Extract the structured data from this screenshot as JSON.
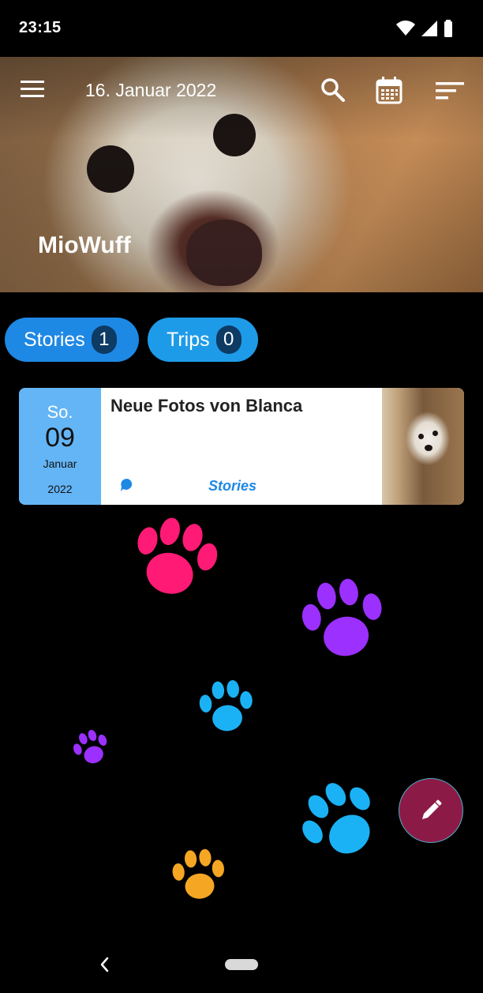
{
  "status_bar": {
    "time": "23:15"
  },
  "header": {
    "date": "16. Januar 2022",
    "app_title": "MioWuff",
    "icons": [
      "menu-icon",
      "search-icon",
      "calendar-icon",
      "sort-icon"
    ]
  },
  "filters": [
    {
      "label": "Stories",
      "count": "1"
    },
    {
      "label": "Trips",
      "count": "0"
    }
  ],
  "entries": [
    {
      "weekday": "So.",
      "day": "09",
      "month": "Januar",
      "year": "2022",
      "title": "Neue Fotos von Blanca",
      "category": "Stories",
      "category_icon": "story-bubble-icon"
    }
  ],
  "fab": {
    "icon": "pencil-icon"
  },
  "colors": {
    "chip": "#1e88e5",
    "chip_count": "#0d3b63",
    "card_date": "#64b5f6",
    "category": "#1e88e5",
    "fab": "#8c1a47",
    "paws": [
      "#ff1a75",
      "#9b30ff",
      "#1ab2f5",
      "#f5a623"
    ]
  }
}
